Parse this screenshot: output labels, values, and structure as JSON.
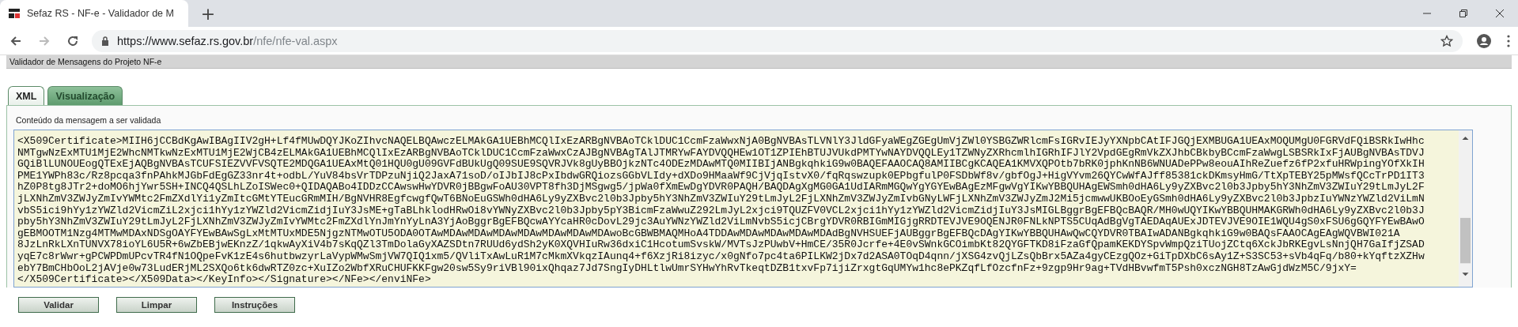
{
  "browser": {
    "tab_title": "Sefaz RS - NF-e - Validador de M",
    "new_tab": "+",
    "url_host": "https://www.sefaz.rs.gov.br",
    "url_path": "/nfe/nfe-val.aspx",
    "forward_disabled": true
  },
  "header": {
    "title": "Validador de Mensagens do Projeto NF-e"
  },
  "tabs": [
    {
      "label": "XML",
      "selected": true
    },
    {
      "label": "Visualização",
      "selected": false
    }
  ],
  "message": {
    "label": "Conteúdo da mensagem a ser validada",
    "lines": [
      "<X509Certificate>MIIH6jCCBdKgAwIBAgIIV2gH+Lf4fMUwDQYJKoZIhvcNAQELBQAwczELMAkGA1UEBhMCQlIxEzARBgNVBAoTCklDUC1CcmFzaWwxNjA0BgNVBAsTLVNlY3JldGFyaWEgZGEgUmVjZWl0YSBGZWRlcmFsIGRvIEJyYXNpbCAtIFJGQjEXMBUGA1UEAxMOQUMgU0FGRVdFQiBSRkIwHhc",
      "NMTgwNzExMTU1MjE2WhcNMTkwNzExMTU1MjE2WjCB4zELMAkGA1UEBhMCQlIxEzARBgNVBAoTCklDUC1CcmFzaWwxCzAJBgNVBAgTAlJTMRYwFAYDVQQHEw1OT1ZPIEhBTUJVUkdPMTYwNAYDVQQLEy1TZWNyZXRhcmlhIGRhIFJlY2VpdGEgRmVkZXJhbCBkbyBCcmFzaWwgLSBSRkIxFjAUBgNVBAsTDVJ",
      "GQiBlLUNOUEogQTExEjAQBgNVBAsTCUFSIEZVVFVSQTE2MDQGA1UEAxMtQ01HQU0gU09GVFdBUkUgQ09SUE9SQVRJVk8gUyBBOjkzNTc4ODEzMDAwMTQ0MIIBIjANBgkqhkiG9w0BAQEFAAOCAQ8AMIIBCgKCAQEA1KMVXQPOtb7bRK0jphKnNB6WNUADePPw8eouAIhReZuefz6fP2xfuHRWpingYOfXkIH",
      "PME1YWPh83c/Rz8pcqa3fnPAhkMJGbFdEgGZ33nr4t+odbL/YuV84bsVrTDPzuNjiQ2JaxA71soD/oIJbIJ8cPxIbdwGRQiozsGGbVLIdy+dXDo9HMaaWf9CjVjqIstvX0/fqRqswzupk0EPbgfulP0FSDbWf8v/gbfOgJ+HigVYvm26QYCwWfAJff85381ckDKmsyHmG/TtXpTEBY25pMWsfQCcTrPD1IT3",
      "hZ0P8tg8JTr2+doMO6hjYwr5SH+INCQ4QSLhLZoISWec0+QIDAQABo4IDDzCCAwswHwYDVR0jBBgwFoAU30VPT8fh3DjMSgwg5/jpWa0fXmEwDgYDVR0PAQH/BAQDAgXgMG0GA1UdIARmMGQwYgYGYEwBAgEzMFgwVgYIKwYBBQUHAgEWSmh0dHA6Ly9yZXBvc2l0b3Jpby5hY3NhZmV3ZWIuY29tLmJyL2F",
      "jLXNhZmV3ZWJyZmIvYWMtc2FmZXdlYi1yZmItcGMtYTEucGRmMIH/BgNVHR8EgfcwgfQwT6BNoEuGSWh0dHA6Ly9yZXBvc2l0b3Jpby5hY3NhZmV3ZWIuY29tLmJyL2FjLXNhZmV3ZWJyZmIvbGNyLWFjLXNhZmV3ZWJyZmJ2Mi5jcmwwUKBOoEyGSmh0dHA6Ly9yZXBvc2l0b3JpbzIuYWNzYWZld2ViLmN",
      "vbS5ici9hYy1zYWZld2VicmZiL2xjci1hYy1zYWZld2VicmZidjIuY3JsME+gTaBLhklodHRwOi8vYWNyZXBvc2l0b3Jpby5pY3BicmFzaWwuZ292LmJyL2xjci9TQUZFV0VCL2xjci1hYy1zYWZld2VicmZidjIuY3JsMIGLBggrBgEFBQcBAQR/MH0wUQYIKwYBBQUHMAKGRWh0dHA6Ly9yZXBvc2l0b3J",
      "pby5hY3NhZmV3ZWIuY29tLmJyL2FjLXNhZmV3ZWJyZmIvYWMtc2FmZXdlYnJmYnYyLnA3YjAoBggrBgEFBQcwAYYcaHR0cDovL29jc3AuYWNzYWZld2ViLmNvbS5icjCBrgYDVR0RBIGmMIGjgRRDTEVJVE9OQENJR0FNLkNPTS5CUqAdBgVgTAEDAqAUExJDTEVJVE9OIE1WQU4gS0xFSU6gGQYFYEwBAwO",
      "gEBMOOTM1Nzg4MTMwMDAxNDSgOAYFYEwBAwSgLxMtMTUxMDE5NjgzNTMwOTU5ODA0OTAwMDAwMDAwMDAwMDAwMDAwMDAwMDAwoBcGBWBMAQMHoA4TDDAwMDAwMDAwMDAwMDAdBgNVHSUEFjAUBggrBgEFBQcDAgYIKwYBBQUHAwQwCQYDVR0TBAIwADANBgkqhkiG9w0BAQsFAAOCAgEAgWQVBWI021A",
      "8JzLnRkLXnTUNVX78ioYL6U5R+6wZbEBjwEKnzZ/1qkwAyXiV4b7sKqQZl3TmDolaGyXAZSDtn7RUUd6ydSh2yK0XQVHIuRw36dxiC1HcotumSvskW/MVTsJzPUwbV+HmCE/35R0Jcrfe+4E0vSWnkGCOimbKt82QYGFTKD8iFzaGfQpamKEKDYSpvWmpQziTUojZCtq6XckJbRKEgvLsNnjQH7GaIfjZSAD",
      "yqE7c8rWwr+gPCWPDmUPcvTR4fN1OQpeFvK1zE4s6hutbwzyrLaVypWMwSmjVW7QIQ1xm5/QVliTxAwLuR1M7cMkmXVkqzIAunq4+f6XzjRi8izyc/x0gNfo7pc4ta6PILKW2jDx7d2ASA0TOqD4qnn/jXSG4zvQjLZsQbBrx5AZa4gyCEzgQOz+GiTpDXbC6sAy1Z+S3SC53+sVb4qFq/b80+kYqftzXZHw",
      "ebY7BmCHbOoL2jAVje0w73LudERjML2SXQo6tk6dwRTZ0zc+XuIZo2WbfXRuCHUFKKFgw20sw5Sy9riVBl90ixQhqaz7Jd7SngIyDHLtlwUmrSYHwYhRvTkeqtDZB1txvFp7ijiZrxgtGqUMYw1hc8ePKZqfLfOzcfnFz+9zgp9Hr9ag+TVdHBvwfmT5Psh0xczNGH8TzAwGjdWzM5C/9jxY=",
      "</X509Certificate></X509Data></KeyInfo></Signature></NFe></enviNFe>"
    ]
  },
  "buttons": [
    "Validar",
    "Limpar",
    "Instruções"
  ]
}
